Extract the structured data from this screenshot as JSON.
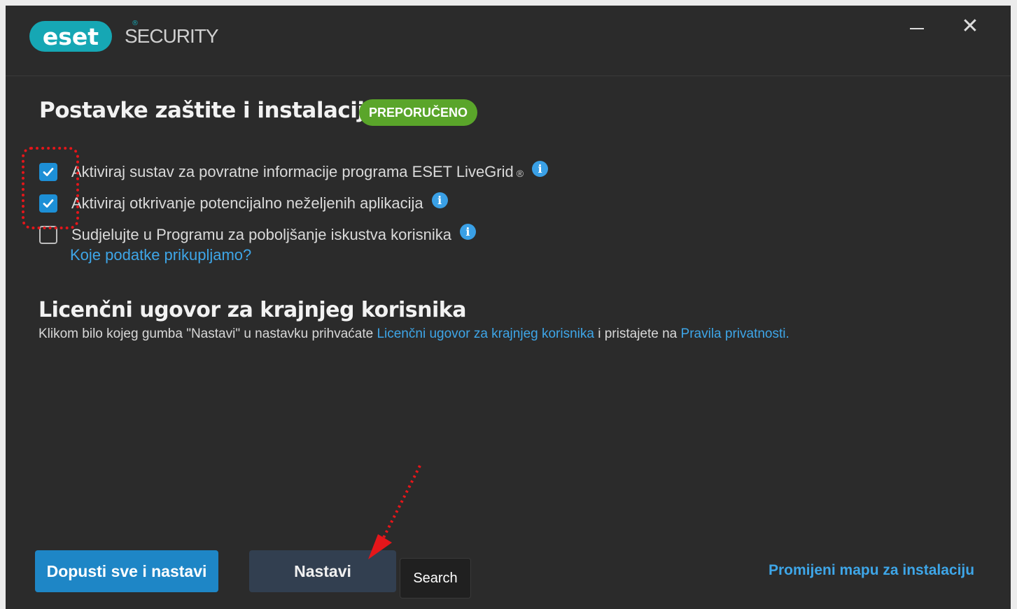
{
  "titlebar": {
    "logo_text": "eset",
    "logo_reg": "®",
    "product": "SECURITY",
    "minimize_icon": "minimize-icon",
    "close_icon": "close-icon",
    "close_glyph": "✕"
  },
  "protection": {
    "title": "Postavke zaštite i instalacije",
    "badge": "PREPORUČENO",
    "badge_color": "#5aa52a",
    "options": [
      {
        "label": "Aktiviraj sustav za povratne informacije programa ESET LiveGrid",
        "suffix": "®",
        "checked": true
      },
      {
        "label": "Aktiviraj otkrivanje potencijalno neželjenih aplikacija",
        "checked": true
      },
      {
        "label": "Sudjelujte u Programu za poboljšanje iskustva korisnika",
        "checked": false
      }
    ],
    "data_link": "Koje podatke prikupljamo?"
  },
  "eula": {
    "title": "Licenčni ugovor za krajnjeg korisnika",
    "text_before": "Klikom bilo kojeg gumba \"Nastavi\" u nastavku prihvaćate ",
    "eula_link": "Licenčni ugovor za krajnjeg korisnika",
    "text_middle": " i pristajete na ",
    "privacy_link": "Pravila privatnosti."
  },
  "footer": {
    "allow_all_button": "Dopusti sve i nastavi",
    "continue_button": "Nastavi",
    "search_label": "Search",
    "change_folder_link": "Promijeni mapu za instalaciju"
  },
  "colors": {
    "accent": "#1e86c6",
    "link": "#3ea6e8",
    "background": "#2b2b2b",
    "annotation": "#e5161a"
  }
}
